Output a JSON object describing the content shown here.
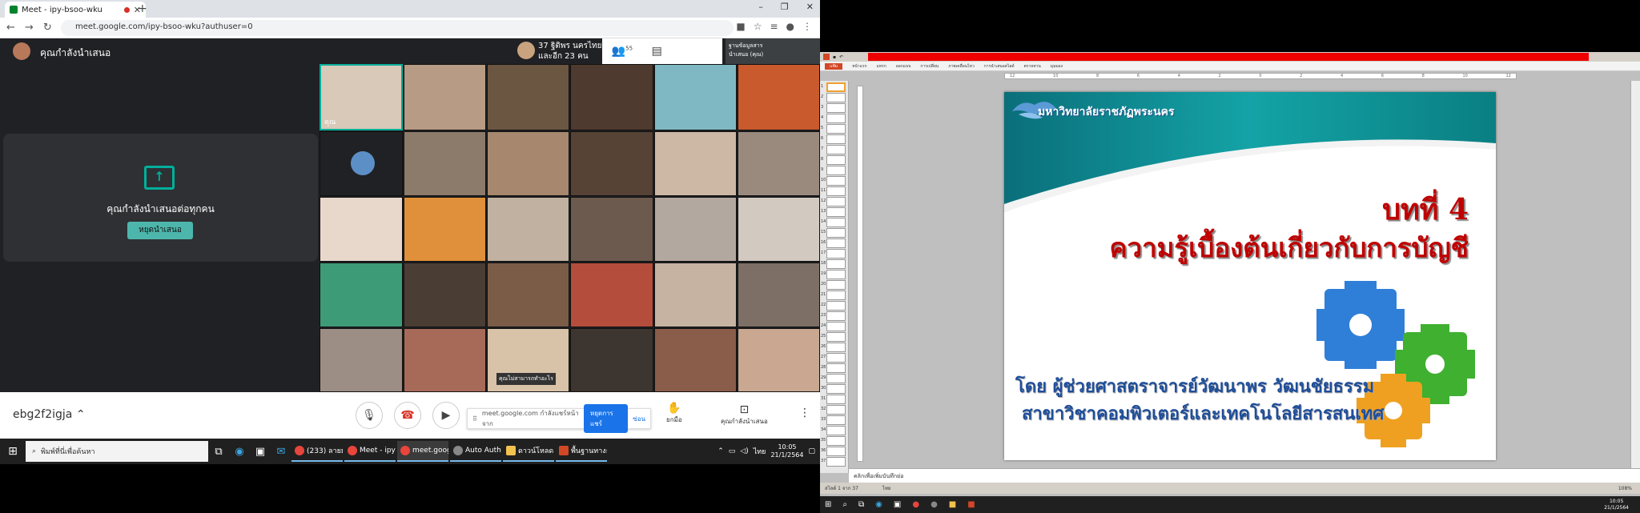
{
  "browser": {
    "tab_title": "Meet - ipy-bsoo-wku",
    "url": "meet.google.com/ipy-bsoo-wku?authuser=0",
    "new_tab": "+"
  },
  "meet": {
    "presenting_label": "คุณกำลังนำเสนอ",
    "participant_line1": "37 ฐิติพร นครไทย",
    "participant_line2": "และอีก 23 คน",
    "people_count": "55",
    "clock": "10:05",
    "self_label": "ฐานข้อมูลสาร\nนำเสนอ (คุณ)",
    "present_card_text": "คุณกำลังนำเสนอต่อทุกคน",
    "stop_presenting": "หยุดนำเสนอ",
    "you_label": "คุณ",
    "caption": "คุณไม่สามารถทำอะไร",
    "meeting_code": "ebg2f2igja",
    "share_bar_text": "meet.google.com กำลังแชร์หน้าจาก",
    "stop_sharing": "หยุดการแชร์",
    "hide": "ซ่อน",
    "raise_hand": "ยกมือ",
    "presenting_now": "คุณกำลังนำเสนอ"
  },
  "taskbar_left": {
    "search_placeholder": "พิมพ์ที่นี่เพื่อค้นหา",
    "apps": [
      {
        "label": "(233) ลายมุ่งลิ...",
        "color": "#e8453c"
      },
      {
        "label": "Meet - ipy-b...",
        "color": "#e8453c"
      },
      {
        "label": "meet.googl...",
        "color": "#e8453c"
      },
      {
        "label": "Auto Authe...",
        "color": "#888888"
      },
      {
        "label": "ดาวน์โหลด",
        "color": "#f2c14e"
      },
      {
        "label": "พื้นฐานทางธุร...",
        "color": "#d24726"
      }
    ],
    "lang": "ไทย",
    "time": "10:05",
    "date": "21/1/2564"
  },
  "powerpoint": {
    "menu": [
      "แฟ้ม",
      "หน้าแรก",
      "แทรก",
      "ออกแบบ",
      "การเปลี่ยน",
      "ภาพเคลื่อนไหว",
      "การนำเสนอสไลด์",
      "ตรวจทาน",
      "มุมมอง"
    ],
    "slide_header": "มหาวิทยาลัยราชภัฏพระนคร",
    "chapter": "บทที่ 4",
    "subject": "ความรู้เบื้องต้นเกี่ยวกับการบัญชี",
    "author_line1": "โดย ผู้ช่วยศาสตราจารย์วัฒนาพร  วัฒนชัยธรรม",
    "author_line2": "สาขาวิชาคอมพิวเตอร์และเทคโนโลยีสารสนเทศ",
    "notes_placeholder": "คลิกเพื่อเพิ่มบันทึกย่อ",
    "status_slide": "สไลด์ 1 จาก 37",
    "status_lang": "ไทย",
    "zoom": "108%",
    "taskbar_time": "10:05",
    "taskbar_date": "21/1/2564"
  },
  "colors": {
    "meet_bg": "#202124",
    "meet_accent": "#00af9b",
    "end_call": "#d93025",
    "slide_title": "#c00000",
    "slide_author": "#1f4e9a",
    "slide_teal": "#0a8a8a"
  }
}
